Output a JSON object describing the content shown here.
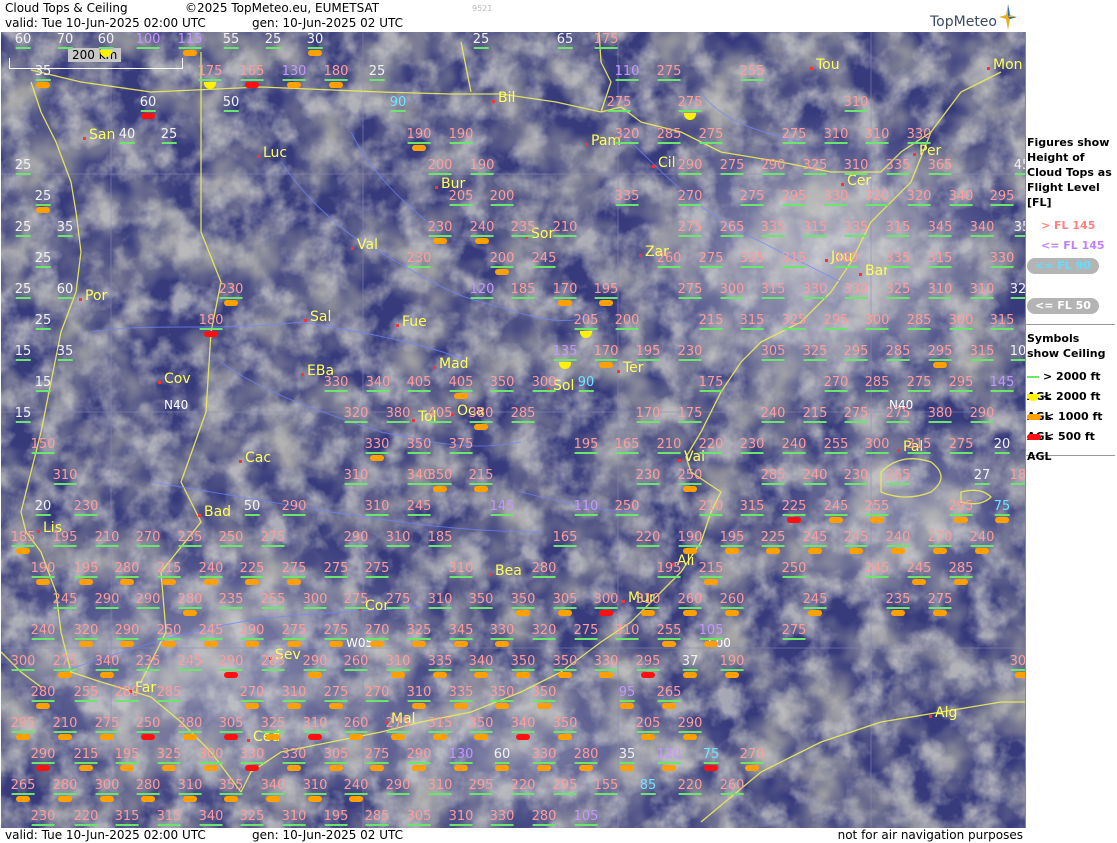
{
  "header": {
    "title": "Cloud Tops & Ceiling",
    "copyright": "©2025 TopMeteo.eu, EUMETSAT",
    "valid": "valid:  Tue  10-Jun-2025  02:00 UTC",
    "gen": "gen: 10-Jun-2025 02 UTC",
    "code": "9521",
    "logo": "TopMeteo",
    "logo_icon": "compass-star-icon"
  },
  "footer": {
    "valid": "valid:  Tue  10-Jun-2025  02:00 UTC",
    "gen": "gen: 10-Jun-2025 02 UTC",
    "disclaimer": "not for air navigation purposes"
  },
  "scale_bar": "200 km",
  "grid_labels": [
    "N40",
    "N40",
    "W05",
    "E00"
  ],
  "legend": {
    "heights_title": "Figures show Height of Cloud Tops as Flight Level  [FL]",
    "fl": [
      {
        "label": "> FL 145",
        "color": "#ff8080"
      },
      {
        "label": "<= FL 145",
        "color": "#c080ff"
      },
      {
        "label": "<= FL 90",
        "color": "#5ee0ff",
        "pill": true
      },
      {
        "label": "<= FL 70",
        "color": "#ffffff"
      },
      {
        "label": "<= FL 50",
        "color": "#ffffff",
        "pill": true
      }
    ],
    "symbols_title": "Symbols show Ceiling",
    "symbols": [
      {
        "label": "> 2000 ft AGL",
        "symbol": "green-line"
      },
      {
        "label": "< 2000 ft AGL",
        "symbol": "yellow-cup"
      },
      {
        "label": "< 1000 ft AGL",
        "symbol": "orange-bar"
      },
      {
        "label": "< 500 ft AGL",
        "symbol": "red-bar"
      }
    ]
  },
  "cities": [
    "Tou",
    "Mon",
    "Bil",
    "San",
    "Luc",
    "Pam",
    "Per",
    "Cil",
    "Cer",
    "Bur",
    "Val",
    "Sor",
    "Zar",
    "Jou",
    "Bar",
    "Por",
    "Sal",
    "Fue",
    "Mad",
    "Cov",
    "EBa",
    "Ter",
    "Tol",
    "Oca",
    "Sol",
    "Val",
    "Cac",
    "Pal",
    "Bad",
    "Lis",
    "Ali",
    "Bea",
    "Mur",
    "Cor",
    "Sev",
    "Far",
    "Mal",
    "Ced",
    "Alg"
  ],
  "values": [
    "60",
    "70",
    "60",
    "100",
    "115",
    "55",
    "25",
    "30",
    "25",
    "65",
    "175",
    "35",
    "175",
    "165",
    "130",
    "180",
    "25",
    "110",
    "275",
    "255",
    "60",
    "50",
    "90",
    "275",
    "275",
    "310",
    "40",
    "25",
    "190",
    "190",
    "320",
    "285",
    "275",
    "275",
    "310",
    "310",
    "330",
    "25",
    "200",
    "190",
    "290",
    "275",
    "290",
    "325",
    "310",
    "335",
    "365",
    "45",
    "25",
    "205",
    "200",
    "335",
    "270",
    "275",
    "295",
    "330",
    "320",
    "320",
    "340",
    "295",
    "25",
    "35",
    "230",
    "240",
    "235",
    "210",
    "275",
    "265",
    "335",
    "315",
    "335",
    "315",
    "345",
    "340",
    "35",
    "25",
    "230",
    "200",
    "245",
    "260",
    "275",
    "335",
    "315",
    "360",
    "335",
    "315",
    "330",
    "25",
    "60",
    "230",
    "120",
    "185",
    "170",
    "195",
    "275",
    "300",
    "315",
    "330",
    "330",
    "325",
    "310",
    "310",
    "32",
    "25",
    "180",
    "205",
    "200",
    "215",
    "315",
    "325",
    "295",
    "300",
    "285",
    "300",
    "315",
    "15",
    "35",
    "135",
    "170",
    "195",
    "230",
    "305",
    "325",
    "295",
    "285",
    "295",
    "315",
    "10",
    "15",
    "330",
    "340",
    "405",
    "405",
    "350",
    "300",
    "90",
    "175",
    "270",
    "285",
    "275",
    "295",
    "145",
    "15",
    "320",
    "380",
    "405",
    "380",
    "285",
    "170",
    "175",
    "240",
    "215",
    "275",
    "275",
    "380",
    "290",
    "150",
    "330",
    "350",
    "375",
    "195",
    "165",
    "210",
    "220",
    "230",
    "240",
    "255",
    "300",
    "315",
    "275",
    "20",
    "310",
    "310",
    "340",
    "350",
    "215",
    "230",
    "250",
    "285",
    "240",
    "230",
    "265",
    "27",
    "180",
    "20",
    "230",
    "50",
    "290",
    "310",
    "245",
    "145",
    "110",
    "250",
    "210",
    "315",
    "225",
    "245",
    "255",
    "295",
    "75",
    "185",
    "195",
    "210",
    "270",
    "235",
    "250",
    "275",
    "290",
    "310",
    "185",
    "165",
    "220",
    "190",
    "195",
    "225",
    "245",
    "245",
    "240",
    "270",
    "240",
    "190",
    "195",
    "280",
    "215",
    "240",
    "225",
    "275",
    "275",
    "275",
    "310",
    "280",
    "195",
    "215",
    "250",
    "245",
    "245",
    "285",
    "245",
    "290",
    "290",
    "280",
    "235",
    "255",
    "300",
    "275",
    "275",
    "310",
    "350",
    "350",
    "305",
    "300",
    "310",
    "260",
    "260",
    "245",
    "235",
    "275",
    "240",
    "320",
    "290",
    "250",
    "245",
    "290",
    "275",
    "275",
    "270",
    "325",
    "345",
    "330",
    "320",
    "275",
    "310",
    "255",
    "105",
    "275",
    "300",
    "275",
    "340",
    "235",
    "245",
    "290",
    "285",
    "290",
    "260",
    "310",
    "335",
    "340",
    "350",
    "350",
    "330",
    "295",
    "37",
    "190",
    "300",
    "280",
    "255",
    "280",
    "285",
    "270",
    "310",
    "275",
    "270",
    "310",
    "335",
    "350",
    "350",
    "95",
    "265",
    "295",
    "210",
    "275",
    "250",
    "280",
    "305",
    "325",
    "310",
    "260",
    "275",
    "315",
    "350",
    "340",
    "350",
    "205",
    "290",
    "290",
    "215",
    "195",
    "325",
    "300",
    "330",
    "330",
    "305",
    "275",
    "290",
    "130",
    "60",
    "330",
    "280",
    "35",
    "120",
    "75",
    "270",
    "265",
    "280",
    "300",
    "280",
    "310",
    "355",
    "340",
    "310",
    "240",
    "290",
    "310",
    "295",
    "220",
    "295",
    "155",
    "85",
    "220",
    "260",
    "230",
    "220",
    "315",
    "315",
    "340",
    "325",
    "310",
    "195",
    "285",
    "305",
    "310",
    "330",
    "280",
    "105"
  ]
}
